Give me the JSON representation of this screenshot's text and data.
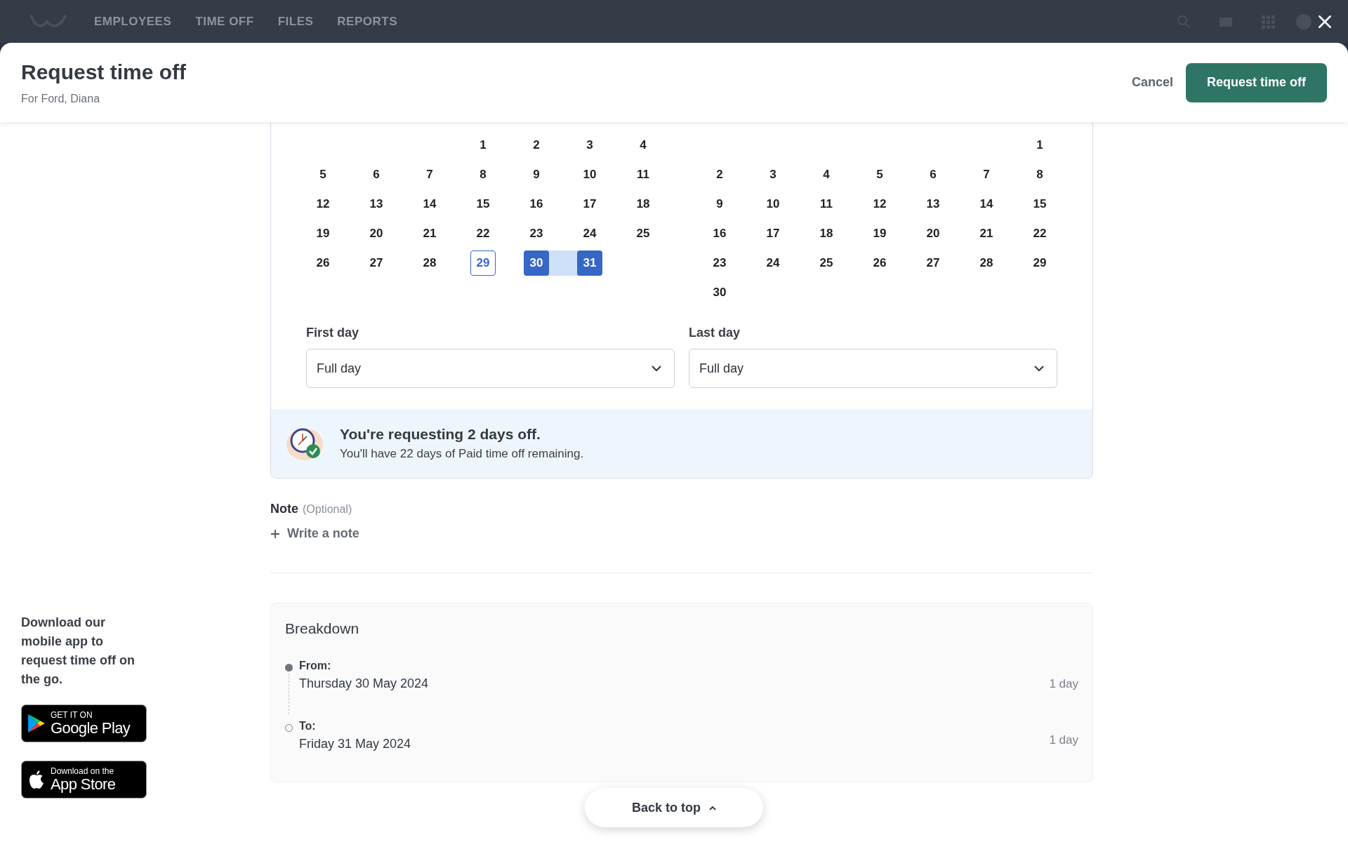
{
  "top_nav": {
    "items": [
      {
        "label": "EMPLOYEES"
      },
      {
        "label": "TIME OFF"
      },
      {
        "label": "FILES"
      },
      {
        "label": "REPORTS"
      }
    ]
  },
  "modal": {
    "title": "Request time off",
    "subtitle": "For Ford, Diana",
    "cancel": "Cancel",
    "submit": "Request time off"
  },
  "calendar": {
    "months": [
      {
        "weeks": [
          [
            {
              "day": "1",
              "selected": false,
              "today": false
            },
            {
              "day": "2",
              "selected": false,
              "today": false
            },
            {
              "day": "3",
              "selected": false,
              "today": false
            },
            {
              "day": "4",
              "selected": false,
              "today": false
            }
          ],
          [
            {
              "day": "5",
              "selected": false,
              "today": false
            },
            {
              "day": "6",
              "selected": false,
              "today": false
            },
            {
              "day": "7",
              "selected": false,
              "today": false
            },
            {
              "day": "8",
              "selected": false,
              "today": false
            },
            {
              "day": "9",
              "selected": false,
              "today": false
            },
            {
              "day": "10",
              "selected": false,
              "today": false
            },
            {
              "day": "11",
              "selected": false,
              "today": false
            }
          ],
          [
            {
              "day": "12",
              "selected": false,
              "today": false
            },
            {
              "day": "13",
              "selected": false,
              "today": false
            },
            {
              "day": "14",
              "selected": false,
              "today": false
            },
            {
              "day": "15",
              "selected": false,
              "today": false
            },
            {
              "day": "16",
              "selected": false,
              "today": false
            },
            {
              "day": "17",
              "selected": false,
              "today": false
            },
            {
              "day": "18",
              "selected": false,
              "today": false
            }
          ],
          [
            {
              "day": "19",
              "selected": false,
              "today": false
            },
            {
              "day": "20",
              "selected": false,
              "today": false
            },
            {
              "day": "21",
              "selected": false,
              "today": false
            },
            {
              "day": "22",
              "selected": false,
              "today": false
            },
            {
              "day": "23",
              "selected": false,
              "today": false
            },
            {
              "day": "24",
              "selected": false,
              "today": false
            },
            {
              "day": "25",
              "selected": false,
              "today": false
            }
          ],
          [
            {
              "day": "26",
              "selected": false,
              "today": false
            },
            {
              "day": "27",
              "selected": false,
              "today": false
            },
            {
              "day": "28",
              "selected": false,
              "today": false
            },
            {
              "day": "29",
              "selected": false,
              "today": true
            },
            {
              "day": "30",
              "selected": true,
              "today": false
            },
            {
              "day": "31",
              "selected": true,
              "today": false
            }
          ]
        ]
      },
      {
        "weeks": [
          [
            {
              "day": "1",
              "selected": false,
              "today": false
            }
          ],
          [
            {
              "day": "2",
              "selected": false,
              "today": false
            },
            {
              "day": "3",
              "selected": false,
              "today": false
            },
            {
              "day": "4",
              "selected": false,
              "today": false
            },
            {
              "day": "5",
              "selected": false,
              "today": false
            },
            {
              "day": "6",
              "selected": false,
              "today": false
            },
            {
              "day": "7",
              "selected": false,
              "today": false
            },
            {
              "day": "8",
              "selected": false,
              "today": false
            }
          ],
          [
            {
              "day": "9",
              "selected": false,
              "today": false
            },
            {
              "day": "10",
              "selected": false,
              "today": false
            },
            {
              "day": "11",
              "selected": false,
              "today": false
            },
            {
              "day": "12",
              "selected": false,
              "today": false
            },
            {
              "day": "13",
              "selected": false,
              "today": false
            },
            {
              "day": "14",
              "selected": false,
              "today": false
            },
            {
              "day": "15",
              "selected": false,
              "today": false
            }
          ],
          [
            {
              "day": "16",
              "selected": false,
              "today": false
            },
            {
              "day": "17",
              "selected": false,
              "today": false
            },
            {
              "day": "18",
              "selected": false,
              "today": false
            },
            {
              "day": "19",
              "selected": false,
              "today": false
            },
            {
              "day": "20",
              "selected": false,
              "today": false
            },
            {
              "day": "21",
              "selected": false,
              "today": false
            },
            {
              "day": "22",
              "selected": false,
              "today": false
            }
          ],
          [
            {
              "day": "23",
              "selected": false,
              "today": false
            },
            {
              "day": "24",
              "selected": false,
              "today": false
            },
            {
              "day": "25",
              "selected": false,
              "today": false
            },
            {
              "day": "26",
              "selected": false,
              "today": false
            },
            {
              "day": "27",
              "selected": false,
              "today": false
            },
            {
              "day": "28",
              "selected": false,
              "today": false
            },
            {
              "day": "29",
              "selected": false,
              "today": false
            }
          ],
          [
            {
              "day": "30",
              "selected": false,
              "today": false
            }
          ]
        ]
      }
    ]
  },
  "day_parts": [
    {
      "label": "First day",
      "value": "Full day"
    },
    {
      "label": "Last day",
      "value": "Full day"
    }
  ],
  "summary": {
    "title": "You're requesting 2 days off.",
    "text": "You'll have 22 days of Paid time off remaining."
  },
  "note": {
    "label": "Note",
    "hint": "(Optional)",
    "action": "Write a note"
  },
  "breakdown": {
    "title": "Breakdown",
    "items": [
      {
        "kind": "start",
        "label": "From:",
        "date": "Thursday 30 May 2024",
        "duration": "1 day"
      },
      {
        "kind": "end",
        "label": "To:",
        "date": "Friday 31 May 2024",
        "duration": "1 day"
      }
    ]
  },
  "app_promo": {
    "text": "Download our mobile app to request time off on the go.",
    "badges": [
      {
        "kind": "google",
        "small": "GET IT ON",
        "big": "Google Play"
      },
      {
        "kind": "apple",
        "small": "Download on the",
        "big": "App Store"
      }
    ]
  },
  "back_to_top": "Back to top"
}
